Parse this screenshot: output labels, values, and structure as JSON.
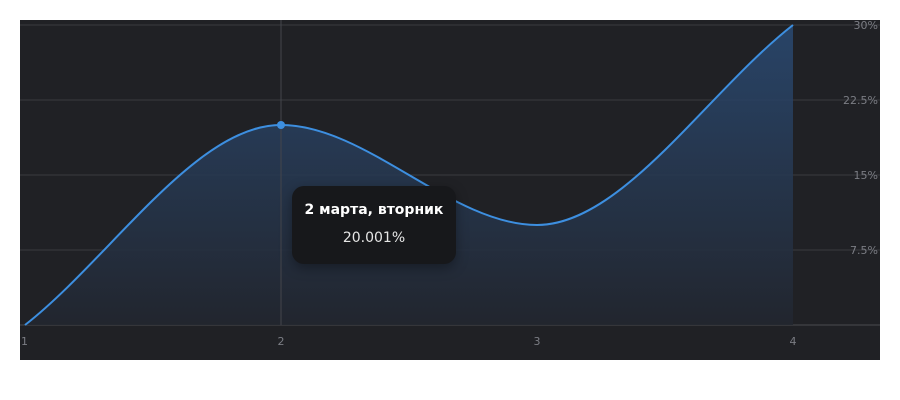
{
  "chart_data": {
    "type": "area",
    "x": [
      1,
      2,
      3,
      4
    ],
    "x_ticks": [
      "1",
      "2",
      "3",
      "4"
    ],
    "xlim": [
      1,
      4.35
    ],
    "y_ticks": [
      "30%",
      "22.5%",
      "15%",
      "7.5%"
    ],
    "y_tick_values": [
      30,
      22.5,
      15,
      7.5
    ],
    "ylim": [
      0,
      30
    ],
    "series": [
      {
        "values": [
          0,
          20.001,
          10,
          30
        ]
      }
    ],
    "smooth": true,
    "grid": true,
    "y_axis_position": "right",
    "highlight": {
      "x": 2,
      "y": 20.001
    },
    "tooltip": {
      "title": "2 марта, вторник",
      "value": "20.001%"
    },
    "colors": {
      "line": "#3d8fe0",
      "background": "#202125",
      "grid": "#3a3b40"
    }
  }
}
